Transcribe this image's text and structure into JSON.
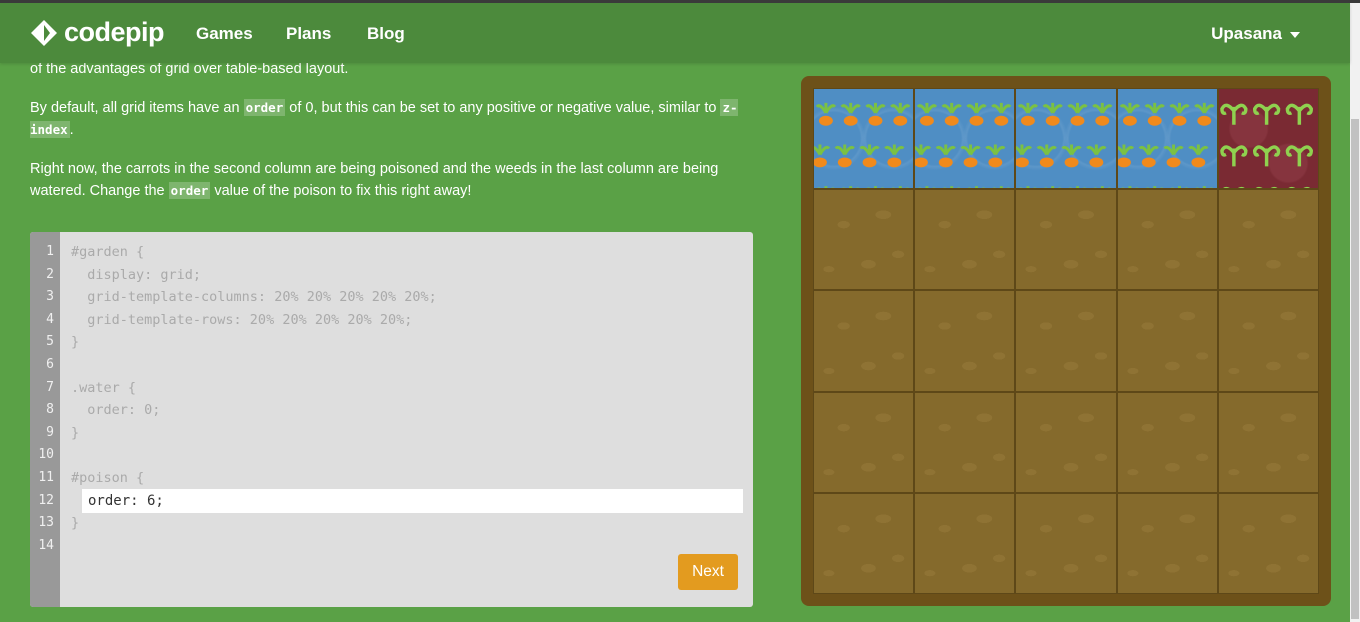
{
  "brand": {
    "name": "codepip"
  },
  "nav": {
    "games": "Games",
    "plans": "Plans",
    "blog": "Blog",
    "user": "Upasana"
  },
  "instructions": {
    "p1": "of the advantages of grid over table-based layout.",
    "p2_a": "By default, all grid items have an ",
    "p2_code1": "order",
    "p2_b": " of 0, but this can be set to any positive or negative value, similar to ",
    "p2_code2": "z-index",
    "p2_c": ".",
    "p3_a": "Right now, the carrots in the second column are being poisoned and the weeds in the last column are being watered. Change the ",
    "p3_code": "order",
    "p3_b": " value of the poison to fix this right away!"
  },
  "editor": {
    "line_numbers": [
      "1",
      "2",
      "3",
      "4",
      "5",
      "6",
      "7",
      "8",
      "9",
      "10",
      "11",
      "12",
      "13",
      "14"
    ],
    "lines": [
      "#garden {",
      "  display: grid;",
      "  grid-template-columns: 20% 20% 20% 20% 20%;",
      "  grid-template-rows: 20% 20% 20% 20% 20%;",
      "}",
      "",
      ".water {",
      "  order: 0;",
      "}",
      "",
      "#poison {",
      "",
      "}",
      ""
    ],
    "input_value": "order: 6;",
    "next_label": "Next"
  },
  "garden": {
    "water_tiles": 4,
    "poison_tiles": 1,
    "colors": {
      "water": "#4f8ec4",
      "poison": "#7a2a33",
      "soil": "#856a2c",
      "frame": "#6d5119"
    }
  }
}
